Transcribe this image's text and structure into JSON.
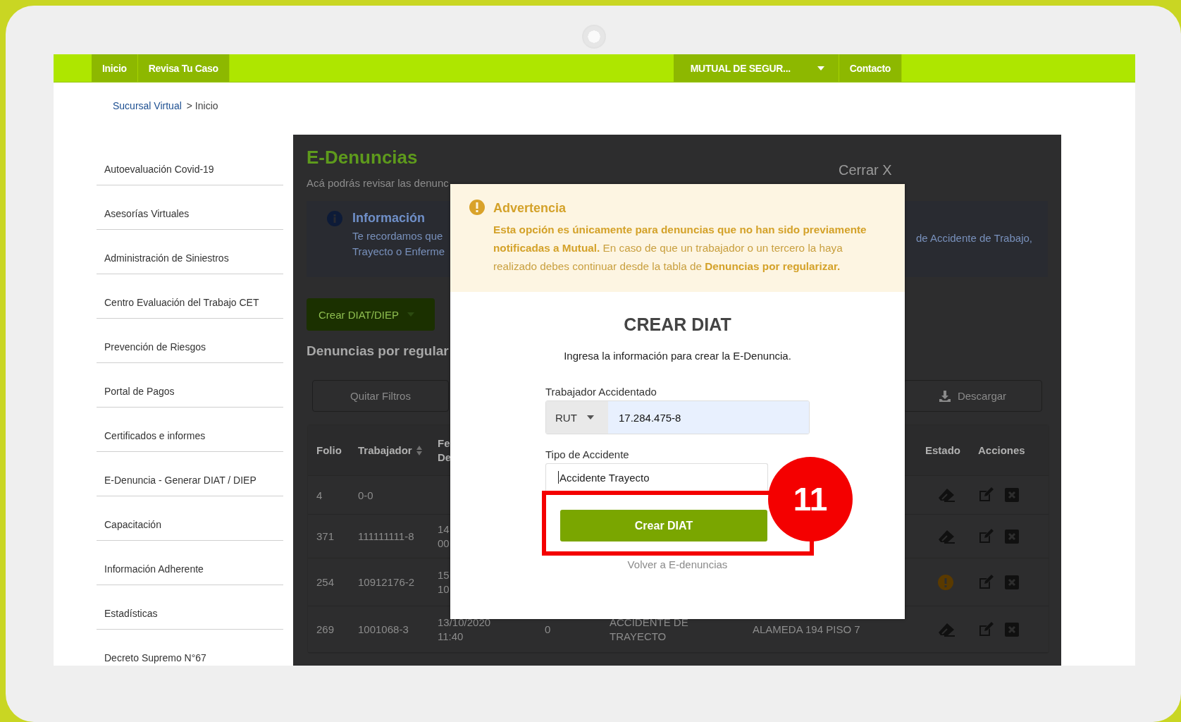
{
  "top_nav": {
    "items": [
      "Inicio",
      "Revisa Tu Caso"
    ],
    "dropdown": "MUTUAL DE SEGUR...",
    "contact": "Contacto"
  },
  "breadcrumb": {
    "link": "Sucursal Virtual",
    "current": "> Inicio"
  },
  "sidebar": {
    "items": [
      "Autoevaluación Covid-19",
      "Asesorías Virtuales",
      "Administración de Siniestros",
      "Centro Evaluación del Trabajo CET",
      "Prevención de Riesgos",
      "Portal de Pagos",
      "Certificados e informes",
      "E-Denuncia - Generar DIAT / DIEP",
      "Capacitación",
      "Información Adherente",
      "Estadísticas",
      "Decreto Supremo N°67"
    ]
  },
  "page": {
    "title": "E-Denuncias",
    "subtitle": "Acá podrás revisar las denunc",
    "close": "Cerrar X",
    "info": {
      "title": "Información",
      "text_left": [
        "Te recordamos que",
        "Trayecto o Enferme"
      ],
      "text_right": "de Accidente de Trabajo,"
    },
    "create_button": "Crear DIAT/DIEP",
    "section_title": "Denuncias por regular",
    "clear_filters": "Quitar Filtros",
    "download": "Descargar",
    "table": {
      "columns": [
        {
          "lines": [
            "Folio"
          ],
          "sortable": false
        },
        {
          "lines": [
            "Trabajador"
          ],
          "sortable": true
        },
        {
          "lines": [
            "Fe",
            "De"
          ]
        },
        {
          "lines": [
            "Estado"
          ],
          "sortable": false
        },
        {
          "lines": [
            "Acciones"
          ],
          "sortable": false
        }
      ],
      "rows": [
        {
          "folio": "4",
          "worker": "0-0",
          "kind": "eraser"
        },
        {
          "folio": "371",
          "worker": "111111111-8",
          "date": [
            "14",
            "00"
          ],
          "kind": "eraser"
        },
        {
          "folio": "254",
          "worker": "10912176-2",
          "date": [
            "15",
            "10"
          ],
          "kind": "alert"
        },
        {
          "folio": "269",
          "worker": "1001068-3",
          "date": [
            "13/10/2020",
            "11:40"
          ],
          "column_4": "0",
          "column_5": [
            "ACCIDENTE DE",
            "TRAYECTO"
          ],
          "column_6": "ALAMEDA 194 PISO 7",
          "kind": "eraser"
        }
      ]
    }
  },
  "modal": {
    "warning": {
      "title": "Advertencia",
      "text": "**Esta opción es únicamente para denuncias que no han sido previamente notificadas a Mutual.** En caso de que un trabajador o un tercero la haya realizado debes continuar desde la tabla de **Denuncias por regularizar.**"
    },
    "title": "CREAR DIAT",
    "subtitle": "Ingresa la información para crear la E-Denuncia.",
    "worker_label": "Trabajador Accidentado",
    "id_type": "RUT",
    "worker_id": "17.284.475-8",
    "accident_label": "Tipo de Accidente",
    "accident_type": "Accidente Trayecto",
    "submit": "Crear DIAT",
    "back_link": "Volver a E-denuncias"
  },
  "callout": {
    "number": "11"
  }
}
